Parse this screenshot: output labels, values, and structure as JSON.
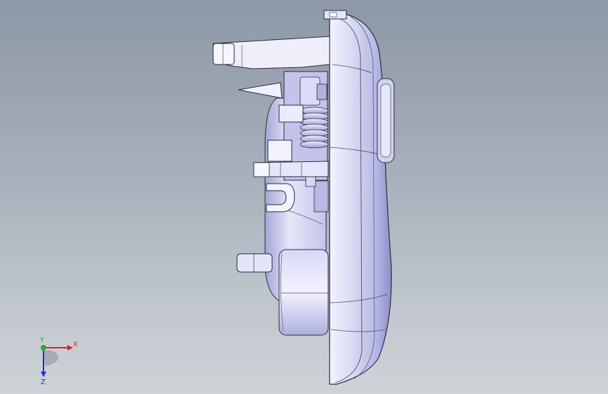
{
  "viewport": {
    "background_top": "#8d98a6",
    "background_bottom": "#cfd3d8",
    "part_color": "#c9c9f0"
  },
  "triad": {
    "x_label": "X",
    "y_label": "Y",
    "z_label": "Z",
    "x_color": "#e02020",
    "y_color": "#20b020",
    "z_color": "#2030d0"
  }
}
